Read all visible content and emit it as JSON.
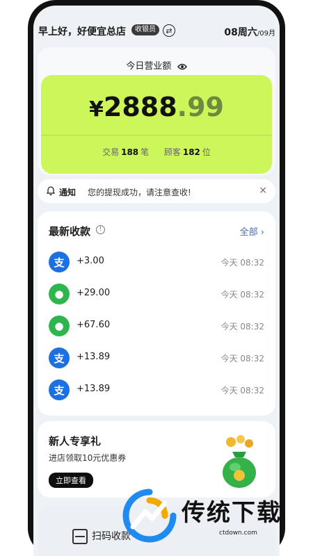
{
  "header": {
    "greeting": "早上好，好便宜总店",
    "role_badge": "收银员",
    "date_main": "08周六",
    "date_sub": "/09月"
  },
  "revenue": {
    "label": "今日营业额",
    "currency": "¥",
    "amount_int": "2888",
    "amount_dec": ".99",
    "trans_label": "交易",
    "trans_count": "188",
    "trans_unit": "笔",
    "cust_label": "顾客",
    "cust_count": "182",
    "cust_unit": "位"
  },
  "notice": {
    "tag": "通知",
    "text": "您的提现成功，请注意查收!",
    "close": "×"
  },
  "receipts": {
    "title": "最新收款",
    "all_label": "全部",
    "items": [
      {
        "method": "alipay",
        "amount": "+3.00",
        "time": "今天 08:32"
      },
      {
        "method": "wechat",
        "amount": "+29.00",
        "time": "今天 08:32"
      },
      {
        "method": "wechat",
        "amount": "+67.60",
        "time": "今天 08:32"
      },
      {
        "method": "alipay",
        "amount": "+13.89",
        "time": "今天 08:32"
      },
      {
        "method": "alipay",
        "amount": "+13.89",
        "time": "今天 08:32"
      }
    ]
  },
  "promo": {
    "title": "新人专享礼",
    "desc": "进店领取10元优惠券",
    "button": "立即查看"
  },
  "scan": {
    "label": "扫码收款"
  },
  "watermark": {
    "title": "传统下载",
    "url": "ctdown.com"
  },
  "colors": {
    "accent_green": "#cdf65a",
    "alipay_blue": "#1e6fe0",
    "wechat_green": "#2fb54d"
  }
}
